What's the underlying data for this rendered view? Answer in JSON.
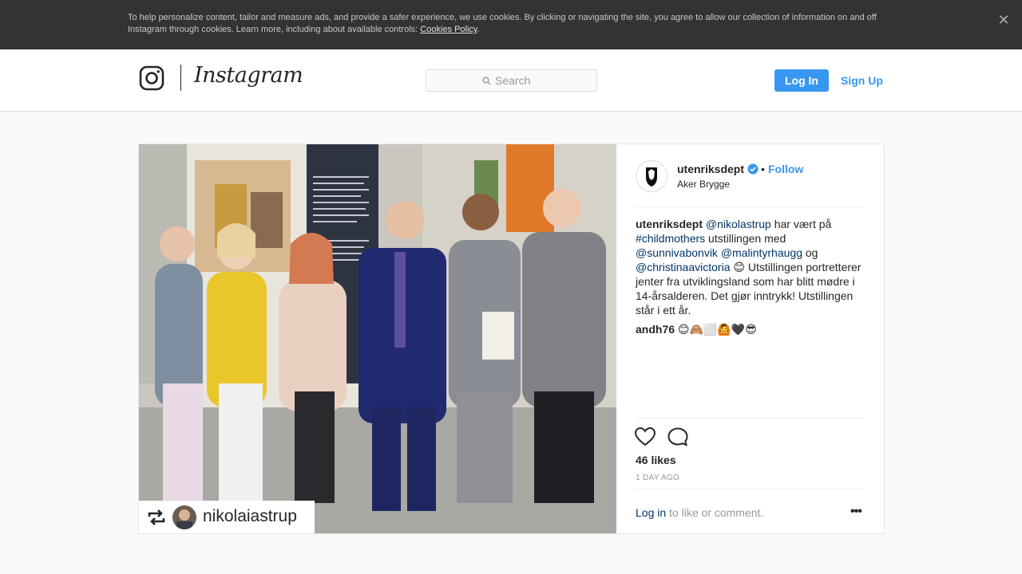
{
  "cookie_banner": {
    "text": "To help personalize content, tailor and measure ads, and provide a safer experience, we use cookies. By clicking or navigating the site, you agree to allow our collection of information on and off Instagram through cookies. Learn more, including about available controls: ",
    "link": "Cookies Policy",
    "period": ".",
    "close": "✕"
  },
  "header": {
    "wordmark": "Instagram",
    "search_placeholder": "Search",
    "login": "Log In",
    "signup": "Sign Up"
  },
  "post": {
    "username": "utenriksdept",
    "dot": "•",
    "follow": "Follow",
    "location": "Aker Brygge",
    "caption": {
      "author": "utenriksdept",
      "mention1": "@nikolastrup",
      "t1": " har vært på ",
      "hashtag": "#childmothers",
      "t2": " utstillingen med ",
      "mention2": "@sunnivabonvik",
      "t3": " ",
      "mention3": "@malintyrhaugg",
      "t4": " og ",
      "mention4": "@christinaavictoria",
      "t5": " 😊 Utstillingen portretterer jenter fra utviklingsland som har blitt mødre i 14-årsalderen. Det gjør inntrykk! Utstillingen står i ett år."
    },
    "comment": {
      "author": "andh76",
      "text": " 😊🙈⬜🙆🖤😎"
    },
    "likes": "46 likes",
    "time": "1 DAY AGO",
    "login_link": "Log in",
    "login_rest": " to like or comment.",
    "more": "•••",
    "repost_name": "nikolaiastrup"
  },
  "colors": {
    "accent": "#3897f0",
    "link": "#003569",
    "banner": "#333333"
  }
}
